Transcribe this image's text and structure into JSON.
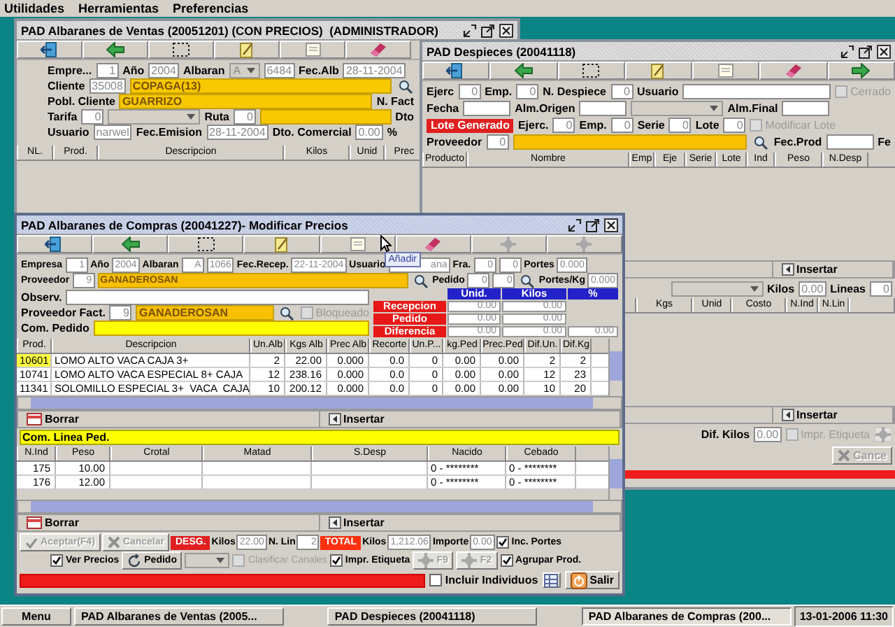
{
  "menu_bar": [
    "Utilidades",
    "Herramientas",
    "Preferencias"
  ],
  "sales_window": {
    "title": "PAD Albaranes de Ventas (20051201) (CON PRECIOS)  (ADMINISTRADOR)",
    "active": false,
    "form_rows": [
      [
        {
          "kind": "label",
          "text": "Empre..."
        },
        {
          "kind": "field",
          "value": "1"
        },
        {
          "kind": "label",
          "text": "Año"
        },
        {
          "kind": "field",
          "value": "2004"
        },
        {
          "kind": "label",
          "text": "Albaran"
        },
        {
          "kind": "combo",
          "value": "A"
        },
        {
          "kind": "field",
          "value": "6484"
        },
        {
          "kind": "label",
          "text": "Fec.Alb"
        },
        {
          "kind": "field",
          "value": "28-11-2004"
        }
      ],
      [
        {
          "kind": "label",
          "text": "Cliente"
        },
        {
          "kind": "field",
          "value": "35008"
        },
        {
          "kind": "bar",
          "value": "COPAGA(13)",
          "color": "#f8c800"
        },
        {
          "kind": "search"
        }
      ],
      [
        {
          "kind": "label",
          "text": "Pobl. Cliente"
        },
        {
          "kind": "bar",
          "value": "GUARRIZO",
          "color": "#f8c800"
        },
        {
          "kind": "label",
          "text": "N. Fact"
        }
      ],
      [
        {
          "kind": "label",
          "text": "Tarifa"
        },
        {
          "kind": "field",
          "value": "0"
        },
        {
          "kind": "combo"
        },
        {
          "kind": "label",
          "text": "Ruta"
        },
        {
          "kind": "field",
          "value": "0"
        },
        {
          "kind": "bar",
          "color": "#f8c800"
        },
        {
          "kind": "label",
          "text": "Dto"
        }
      ],
      [
        {
          "kind": "label",
          "text": "Usuario"
        },
        {
          "kind": "field",
          "value": "narwel"
        },
        {
          "kind": "label",
          "text": "Fec.Emision"
        },
        {
          "kind": "field",
          "value": "28-11-2004"
        },
        {
          "kind": "label",
          "text": "Dto. Comercial"
        },
        {
          "kind": "field",
          "value": "0.00"
        },
        {
          "kind": "label",
          "text": "%"
        }
      ]
    ],
    "table": {
      "columns": [
        "NL.",
        "Prod.",
        "Descripcion",
        "Kilos",
        "Unid",
        "Prec"
      ]
    }
  },
  "cutting_window": {
    "title": "PAD Despieces (20041118)",
    "active": false,
    "form_rows": [
      [
        {
          "kind": "label",
          "text": "Ejerc"
        },
        {
          "kind": "field",
          "value": "0"
        },
        {
          "kind": "label",
          "text": "Emp."
        },
        {
          "kind": "field",
          "value": "0"
        },
        {
          "kind": "label",
          "text": "N. Despiece"
        },
        {
          "kind": "field",
          "value": "0"
        },
        {
          "kind": "label",
          "text": "Usuario"
        },
        {
          "kind": "longfield"
        },
        {
          "kind": "check",
          "text": "Cerrado",
          "checked": false,
          "disabled": true
        }
      ],
      [
        {
          "kind": "label",
          "text": "Fecha"
        },
        {
          "kind": "field"
        },
        {
          "kind": "label",
          "text": "Alm.Origen"
        },
        {
          "kind": "field"
        },
        {
          "kind": "combo"
        },
        {
          "kind": "label",
          "text": "Alm.Final"
        },
        {
          "kind": "field"
        }
      ],
      [
        {
          "kind": "tag",
          "text": "Lote Generado",
          "color": "#e02020"
        },
        {
          "kind": "label",
          "text": "Ejerc."
        },
        {
          "kind": "field",
          "value": "0"
        },
        {
          "kind": "label",
          "text": "Emp."
        },
        {
          "kind": "field",
          "value": "0"
        },
        {
          "kind": "label",
          "text": "Serie"
        },
        {
          "kind": "field",
          "value": "0"
        },
        {
          "kind": "label",
          "text": "Lote"
        },
        {
          "kind": "field",
          "value": "0"
        },
        {
          "kind": "check",
          "text": "Modificar Lote",
          "checked": false,
          "disabled": true
        }
      ],
      [
        {
          "kind": "label",
          "text": "Proveedor"
        },
        {
          "kind": "field",
          "value": "0"
        },
        {
          "kind": "bar",
          "color": "#f8c000"
        },
        {
          "kind": "search"
        },
        {
          "kind": "label",
          "text": "Fec.Prod"
        },
        {
          "kind": "field"
        },
        {
          "kind": "label",
          "text": "Fe"
        }
      ]
    ],
    "table": {
      "columns": [
        "Producto",
        "Nombre",
        "Emp",
        "Eje",
        "Serie",
        "Lote",
        "Ind",
        "Peso",
        "N.Desp"
      ]
    },
    "table_actions": [
      {
        "kind": "insert",
        "label": "Insertar"
      }
    ],
    "totals_row": [
      {
        "kind": "combo"
      },
      {
        "kind": "label",
        "text": "Kilos"
      },
      {
        "kind": "field",
        "value": "0.00"
      },
      {
        "kind": "label",
        "text": "Lineas"
      },
      {
        "kind": "field",
        "value": "0"
      }
    ],
    "lines_table": {
      "columns": [
        "Kgs",
        "Unid",
        "Costo",
        "N.Ind",
        "N.Lin"
      ]
    },
    "lines_actions": [
      {
        "kind": "insert",
        "label": "Insertar"
      }
    ],
    "bottom_row": [
      {
        "kind": "label",
        "text": "Dif. Kilos"
      },
      {
        "kind": "field",
        "value": "0.00"
      },
      {
        "kind": "check",
        "text": "Impr. Etiqueta",
        "checked": false,
        "disabled": true
      },
      {
        "kind": "iconbutton",
        "disabled": true
      }
    ],
    "cancel_button": {
      "label": "Cance",
      "disabled": true
    }
  },
  "purchase_window": {
    "title": "PAD Albaranes de Compras (20041227)- Modificar Precios",
    "active": true,
    "tooltip": "Añadir",
    "form_rows": [
      [
        {
          "kind": "label",
          "text": "Empresa"
        },
        {
          "kind": "field",
          "value": "1"
        },
        {
          "kind": "label",
          "text": "Año"
        },
        {
          "kind": "field",
          "value": "2004"
        },
        {
          "kind": "label",
          "text": "Albaran"
        },
        {
          "kind": "field",
          "value": "A"
        },
        {
          "kind": "field",
          "value": "1066"
        },
        {
          "kind": "label",
          "text": "Fec.Recep."
        },
        {
          "kind": "field",
          "value": "22-11-2004"
        },
        {
          "kind": "label",
          "text": "Usuario"
        },
        {
          "kind": "tipfield",
          "value": "ana"
        },
        {
          "kind": "label",
          "text": "Fra."
        },
        {
          "kind": "field",
          "value": "0"
        },
        {
          "kind": "field",
          "value": "0"
        },
        {
          "kind": "label",
          "text": "Portes"
        },
        {
          "kind": "field",
          "value": "0.000"
        }
      ],
      [
        {
          "kind": "label",
          "text": "Proveedor"
        },
        {
          "kind": "field",
          "value": "9"
        },
        {
          "kind": "bar",
          "value": "GANADEROSAN",
          "color": "#f8c000"
        },
        {
          "kind": "search"
        },
        {
          "kind": "label",
          "text": "Pedido"
        },
        {
          "kind": "field",
          "value": "0"
        },
        {
          "kind": "field",
          "value": "0"
        },
        {
          "kind": "search"
        },
        {
          "kind": "label",
          "text": "Portes/Kg"
        },
        {
          "kind": "field",
          "value": "0.000"
        }
      ]
    ],
    "detail_rows": [
      [
        {
          "kind": "label",
          "text": "Observ."
        },
        {
          "kind": "longfield"
        }
      ],
      [
        {
          "kind": "label",
          "text": "Proveedor Fact."
        },
        {
          "kind": "field",
          "value": "9"
        },
        {
          "kind": "bar",
          "value": "GANADEROSAN",
          "color": "#f8c000"
        },
        {
          "kind": "search"
        },
        {
          "kind": "check",
          "text": "Bloqueado",
          "checked": false,
          "disabled": true
        }
      ],
      [
        {
          "kind": "label",
          "text": "Com. Pedido"
        },
        {
          "kind": "bar",
          "color": "#ffff00"
        }
      ]
    ],
    "summary": {
      "columns": [
        "Unid.",
        "Kilos",
        "%"
      ],
      "rows": [
        {
          "label": "Recepcion",
          "values": [
            "0.00",
            "0.00"
          ]
        },
        {
          "label": "Pedido",
          "values": [
            "0.00",
            "0.00"
          ]
        },
        {
          "label": "Diferencia",
          "values": [
            "0.00",
            "0.00",
            "0.00"
          ]
        }
      ]
    },
    "lines_table": {
      "columns": [
        "Prod.",
        "Descripcion",
        "Un.Alb",
        "Kgs Alb",
        "Prec Alb",
        "Recorte",
        "Un.P...",
        "kg.Ped",
        "Prec.Ped",
        "Dif.Un.",
        "Dif.Kg"
      ],
      "rows": [
        {
          "selected": true,
          "cells": [
            "10601",
            "LOMO ALTO VACA CAJA 3+",
            "2",
            "22.00",
            "0.000",
            "0.0",
            "0",
            "0.00",
            "0.00",
            "2",
            "2"
          ]
        },
        {
          "selected": false,
          "cells": [
            "10741",
            "LOMO ALTO VACA ESPECIAL 8+ CAJA",
            "12",
            "238.16",
            "0.000",
            "0.0",
            "0",
            "0.00",
            "0.00",
            "12",
            "23"
          ]
        },
        {
          "selected": false,
          "cells": [
            "11341",
            "SOLOMILLO ESPECIAL 3+  VACA  CAJA",
            "10",
            "200.12",
            "0.000",
            "0.0",
            "0",
            "0.00",
            "0.00",
            "10",
            "20"
          ]
        }
      ]
    },
    "lines_actions": [
      {
        "kind": "delete",
        "label": "Borrar"
      },
      {
        "kind": "insert",
        "label": "Insertar"
      }
    ],
    "line_comment": "Com. Linea Ped.",
    "individuals_table": {
      "columns": [
        "N.Ind",
        "Peso",
        "Crotal",
        "Matad",
        "S.Desp",
        "Nacido",
        "Cebado"
      ],
      "rows": [
        {
          "n_ind": "175",
          "peso": "10.00",
          "nacido": "0 - ********",
          "cebado": "0 - ********"
        },
        {
          "n_ind": "176",
          "peso": "12.00",
          "nacido": "0 - ********",
          "cebado": "0 - ********"
        }
      ]
    },
    "individuals_actions": [
      {
        "kind": "delete",
        "label": "Borrar"
      },
      {
        "kind": "insert",
        "label": "Insertar"
      }
    ],
    "footer_rows": [
      [
        {
          "kind": "button",
          "text": "Aceptar(F4)",
          "disabled": true
        },
        {
          "kind": "button",
          "text": "Cancelar",
          "disabled": true
        },
        {
          "kind": "tag",
          "text": "DESG.",
          "color": "#e02020"
        },
        {
          "kind": "label",
          "text": "Kilos"
        },
        {
          "kind": "field",
          "value": "22.00"
        },
        {
          "kind": "label",
          "text": "N. Lin"
        },
        {
          "kind": "field",
          "value": "2"
        },
        {
          "kind": "tag",
          "text": "TOTAL",
          "color": "#ff3010"
        },
        {
          "kind": "label",
          "text": "Kilos"
        },
        {
          "kind": "field",
          "value": "1,212.06"
        },
        {
          "kind": "label",
          "text": "Importe"
        },
        {
          "kind": "field",
          "value": "0.00"
        },
        {
          "kind": "check",
          "text": "Inc. Portes",
          "checked": true,
          "disabled": false
        }
      ],
      [
        {
          "kind": "check",
          "text": "Ver Precios",
          "checked": true,
          "disabled": false
        },
        {
          "kind": "button",
          "text": "Pedido",
          "disabled": false
        },
        {
          "kind": "combo"
        },
        {
          "kind": "check",
          "text": "Clasificar Canales",
          "checked": false,
          "disabled": true
        },
        {
          "kind": "check",
          "text": "Impr. Etiqueta",
          "checked": true,
          "disabled": false
        },
        {
          "kind": "button",
          "text": "F9",
          "disabled": true
        },
        {
          "kind": "button",
          "text": "F2",
          "disabled": true
        },
        {
          "kind": "check",
          "text": "Agrupar Prod.",
          "checked": true,
          "disabled": false
        }
      ],
      [
        {
          "kind": "progress"
        },
        {
          "kind": "check",
          "text": "Incluir Individuos",
          "checked": false,
          "disabled": false
        },
        {
          "kind": "iconbutton",
          "disabled": false
        },
        {
          "kind": "button",
          "text": "Salir",
          "disabled": false
        }
      ]
    ]
  },
  "taskbar": {
    "menu": "Menu",
    "tasks": [
      {
        "label": "PAD Albaranes de Ventas (2005...",
        "selected": false
      },
      {
        "label": "PAD Despieces (20041118)",
        "selected": false
      },
      {
        "label": "PAD Albaranes de Compras (200...",
        "selected": true
      }
    ],
    "clock": "13-01-2006  11:30"
  }
}
